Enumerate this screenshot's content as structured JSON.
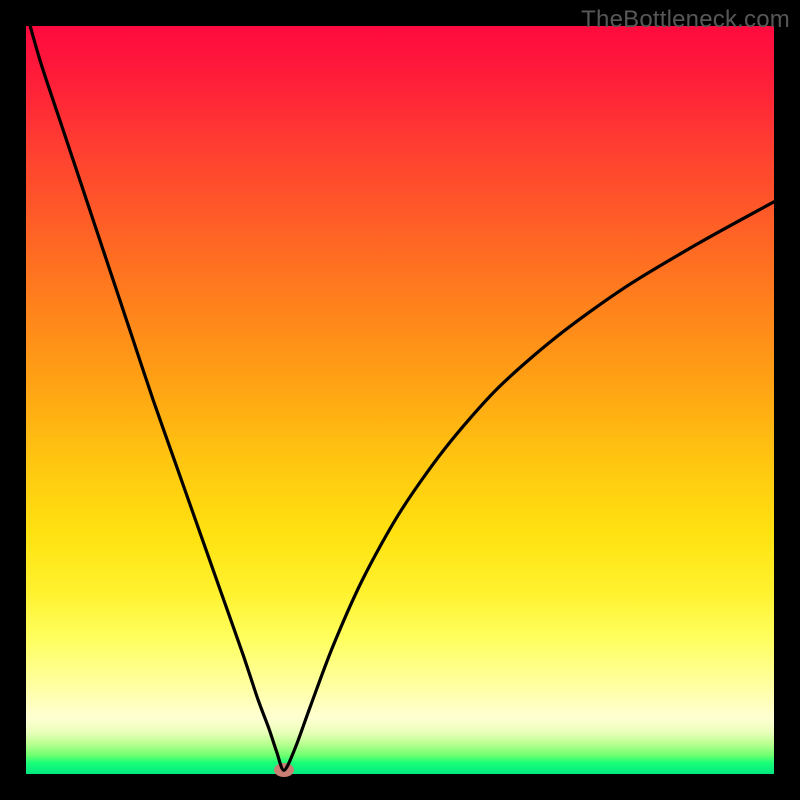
{
  "watermark": "TheBottleneck.com",
  "colors": {
    "frame": "#000000",
    "marker": "#c97f73",
    "curve": "#000000"
  },
  "chart_data": {
    "type": "line",
    "title": "",
    "xlabel": "",
    "ylabel": "",
    "xlim": [
      0,
      100
    ],
    "ylim": [
      0,
      100
    ],
    "x": [
      0,
      2,
      5,
      8,
      11,
      14,
      17,
      20,
      23,
      26,
      29,
      31,
      32.5,
      33.5,
      34.5,
      36,
      38,
      41,
      45,
      50,
      56,
      63,
      71,
      80,
      90,
      100
    ],
    "values": [
      102,
      95,
      86,
      77,
      68,
      59,
      50,
      41.5,
      33,
      24.5,
      16,
      10,
      6,
      3,
      0.5,
      3.5,
      9,
      17,
      26,
      35,
      43.5,
      51.5,
      58.5,
      65,
      71,
      76.5
    ],
    "marker": {
      "x": 34.5,
      "y": 0.5
    },
    "grid": false,
    "legend": false
  }
}
